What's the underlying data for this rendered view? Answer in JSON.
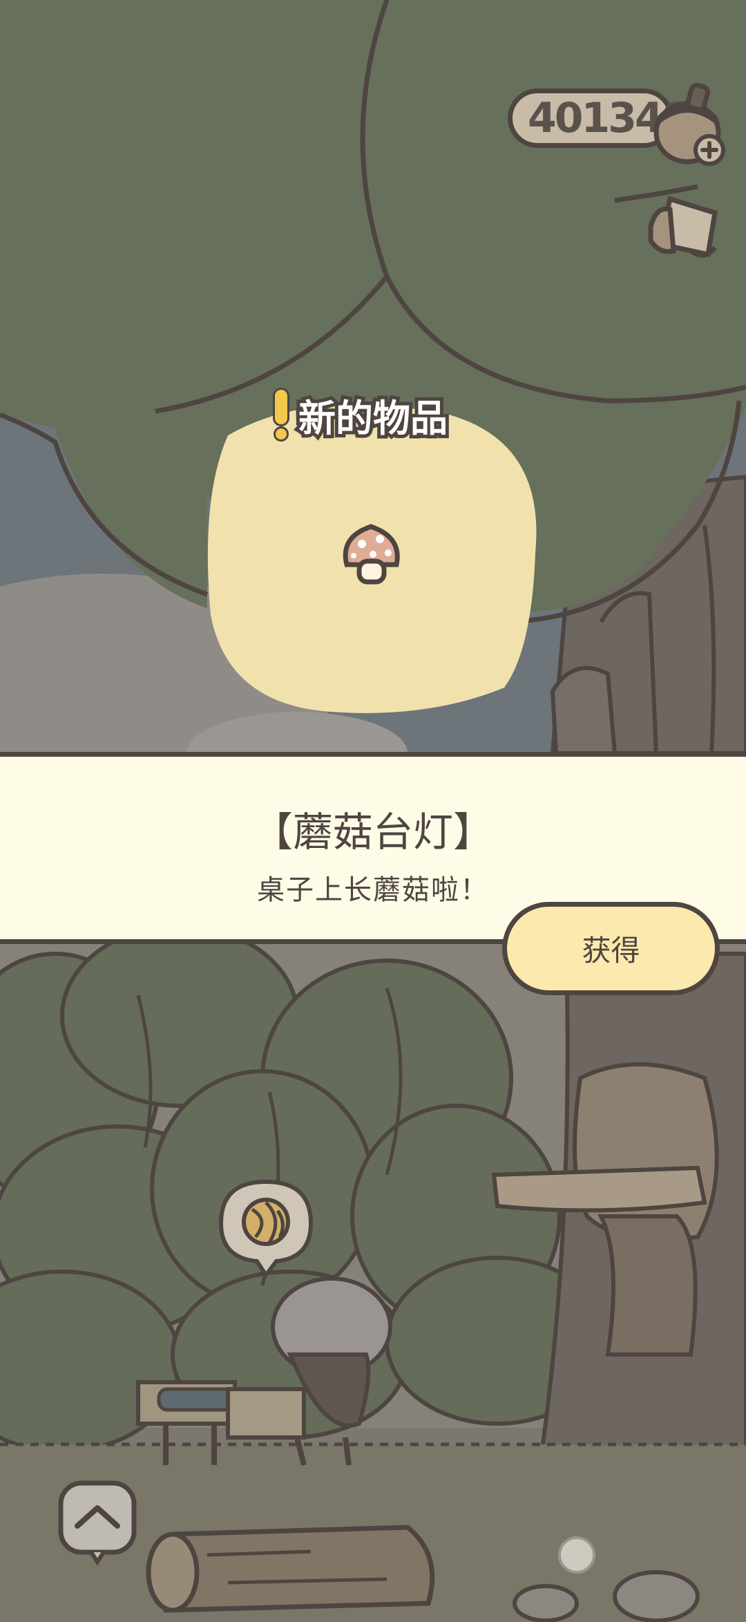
{
  "hud": {
    "acorn_count": "401340",
    "currency_icon": "acorn-icon",
    "add_icon": "plus-icon",
    "mail_icon": "mail-icon"
  },
  "popup": {
    "new_item_label": "新的物品",
    "item_icon": "mushroom-icon",
    "item_name": "【蘑菇台灯】",
    "item_description": "桌子上长蘑菇啦！",
    "obtain_button": "获得"
  },
  "bottom": {
    "expand_icon": "chevron-up-icon",
    "bubble_icon": "yarn-ball-icon"
  },
  "colors": {
    "outline": "#4e4541",
    "banner_bg": "#fefbe6",
    "button_bg": "#fbe9ad",
    "glow": "#f4e6b0",
    "tree": "#6a745c"
  }
}
